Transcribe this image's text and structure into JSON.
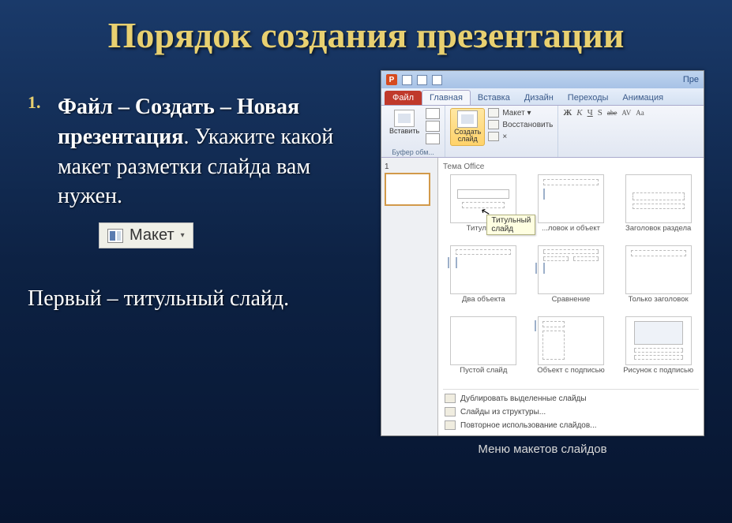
{
  "title": "Порядок создания презентации",
  "list": {
    "num": "1.",
    "bold": "Файл – Создать – Новая презентация",
    "rest": ". Укажите какой макет разметки слайда вам нужен."
  },
  "layoutBtn": {
    "label": "Макет",
    "caret": "▾"
  },
  "para2": "  Первый – титульный слайд.",
  "shot": {
    "appLetter": "P",
    "winTitle": "Пре",
    "fileTab": "Файл",
    "tabs": [
      "Главная",
      "Вставка",
      "Дизайн",
      "Переходы",
      "Анимация"
    ],
    "grpClipboard": {
      "paste": "Вставить",
      "label": "Буфер обм..."
    },
    "grpSlides": {
      "newSlide": "Создать\nслайд",
      "layout": "Макет ▾",
      "reset": "Восстановить",
      "delete": "×"
    },
    "grpFont": {
      "items": [
        "Ж",
        "К",
        "Ч",
        "S",
        "abe",
        "AV",
        "Aa"
      ]
    },
    "slideNum": "1",
    "galleryTitle": "Тема Office",
    "tooltip": "Титульный слайд",
    "layouts": [
      "Титульн...",
      "...ловок и объект",
      "Заголовок раздела",
      "Два объекта",
      "Сравнение",
      "Только заголовок",
      "Пустой слайд",
      "Объект с подписью",
      "Рисунок с подписью"
    ],
    "menu": [
      "Дублировать выделенные слайды",
      "Слайды из структуры...",
      "Повторное использование слайдов..."
    ],
    "caption": "Меню макетов слайдов"
  }
}
